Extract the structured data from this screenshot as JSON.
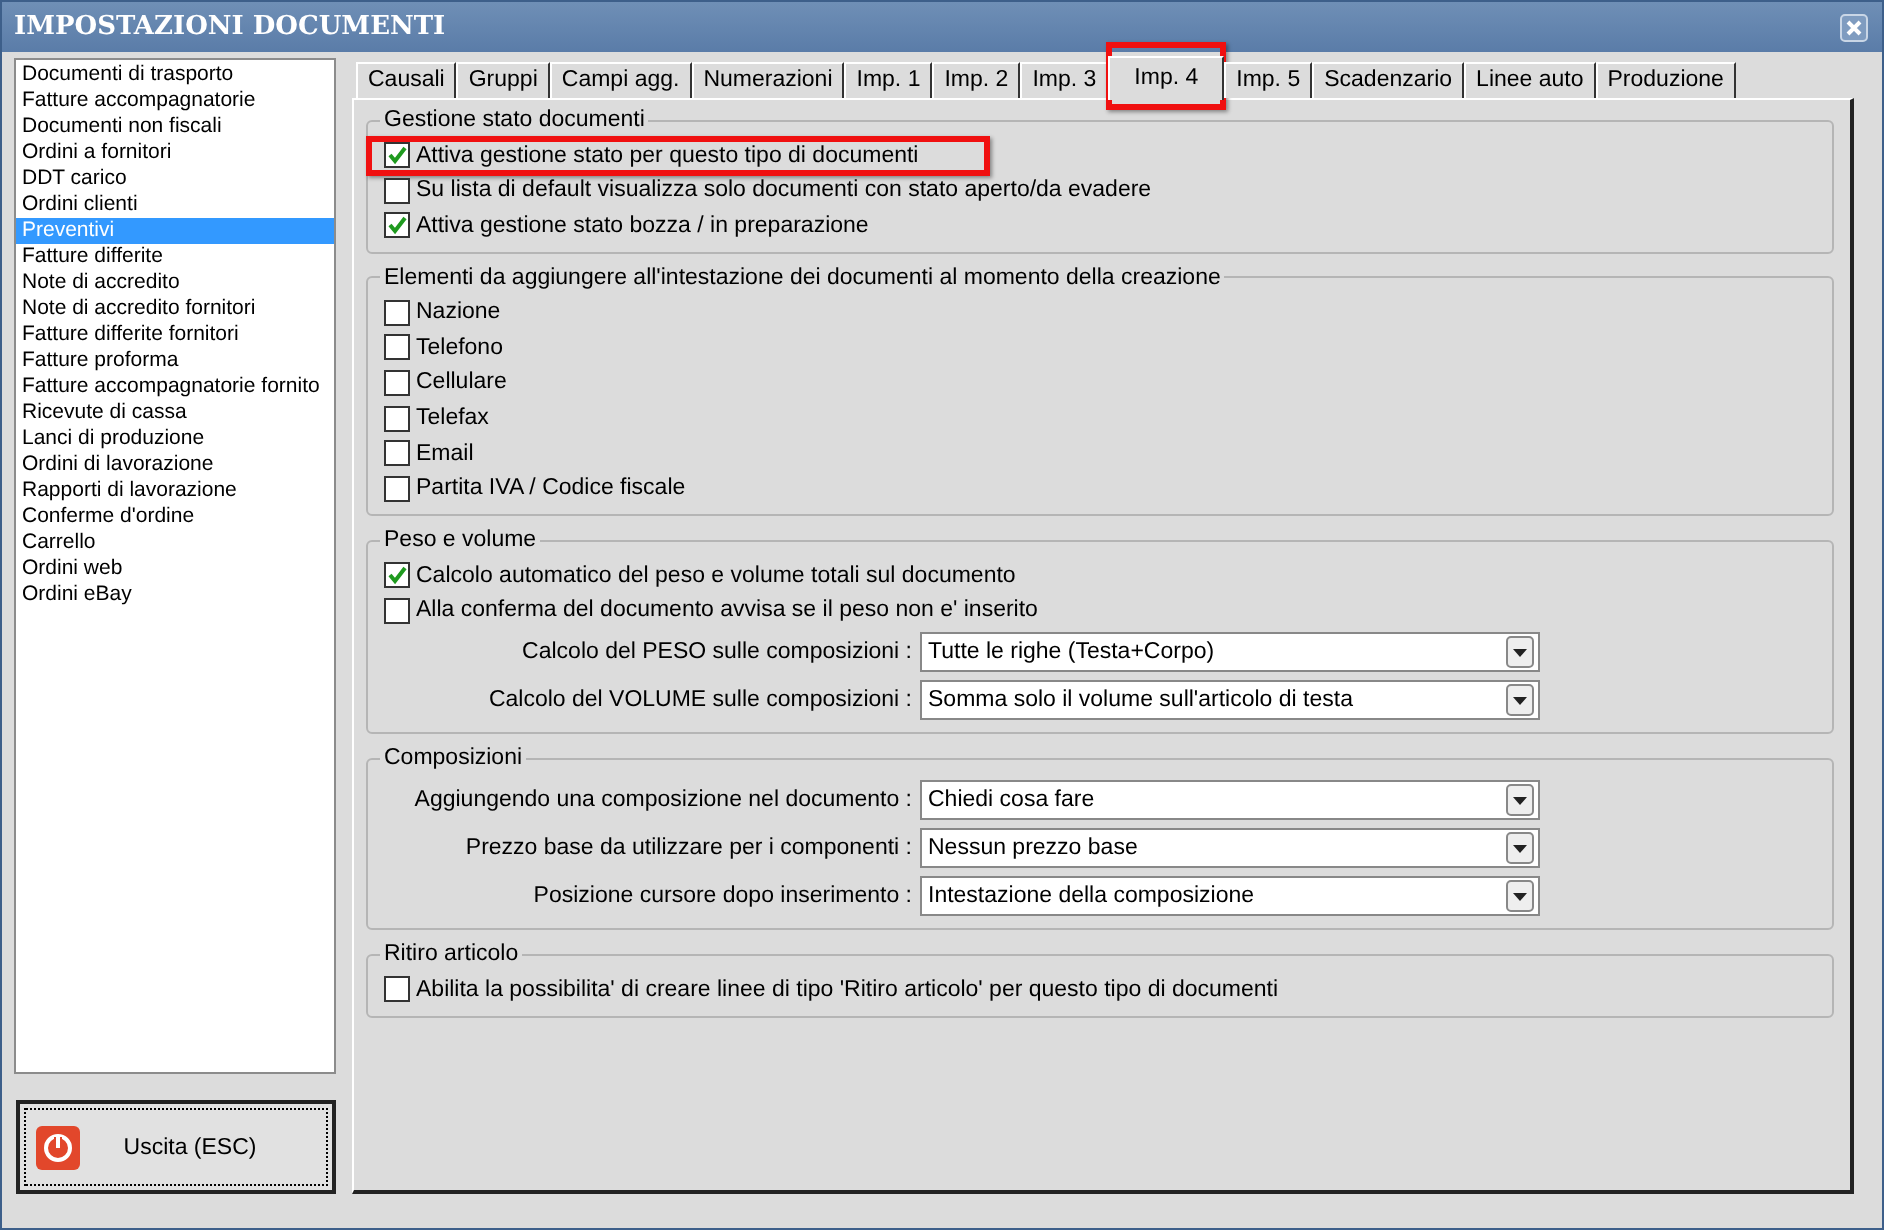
{
  "window": {
    "title": "IMPOSTAZIONI DOCUMENTI"
  },
  "sidebar": {
    "items": [
      {
        "label": "Documenti di trasporto",
        "selected": false
      },
      {
        "label": "Fatture accompagnatorie",
        "selected": false
      },
      {
        "label": "Documenti non fiscali",
        "selected": false
      },
      {
        "label": "Ordini a fornitori",
        "selected": false
      },
      {
        "label": "DDT carico",
        "selected": false
      },
      {
        "label": "Ordini clienti",
        "selected": false
      },
      {
        "label": "Preventivi",
        "selected": true
      },
      {
        "label": "Fatture differite",
        "selected": false
      },
      {
        "label": "Note di accredito",
        "selected": false
      },
      {
        "label": "Note di accredito fornitori",
        "selected": false
      },
      {
        "label": "Fatture differite fornitori",
        "selected": false
      },
      {
        "label": "Fatture proforma",
        "selected": false
      },
      {
        "label": "Fatture accompagnatorie fornito",
        "selected": false
      },
      {
        "label": "Ricevute di cassa",
        "selected": false
      },
      {
        "label": "Lanci di produzione",
        "selected": false
      },
      {
        "label": "Ordini di lavorazione",
        "selected": false
      },
      {
        "label": "Rapporti di lavorazione",
        "selected": false
      },
      {
        "label": "Conferme d'ordine",
        "selected": false
      },
      {
        "label": "Carrello",
        "selected": false
      },
      {
        "label": "Ordini web",
        "selected": false
      },
      {
        "label": "Ordini eBay",
        "selected": false
      }
    ]
  },
  "exit_button": {
    "label": "Uscita (ESC)"
  },
  "tabs": [
    {
      "label": "Causali",
      "selected": false,
      "highlighted": false
    },
    {
      "label": "Gruppi",
      "selected": false,
      "highlighted": false
    },
    {
      "label": "Campi agg.",
      "selected": false,
      "highlighted": false
    },
    {
      "label": "Numerazioni",
      "selected": false,
      "highlighted": false
    },
    {
      "label": "Imp. 1",
      "selected": false,
      "highlighted": false
    },
    {
      "label": "Imp. 2",
      "selected": false,
      "highlighted": false
    },
    {
      "label": "Imp. 3",
      "selected": false,
      "highlighted": false
    },
    {
      "label": "Imp. 4",
      "selected": true,
      "highlighted": true
    },
    {
      "label": "Imp. 5",
      "selected": false,
      "highlighted": false
    },
    {
      "label": "Scadenzario",
      "selected": false,
      "highlighted": false
    },
    {
      "label": "Linee auto",
      "selected": false,
      "highlighted": false
    },
    {
      "label": "Produzione",
      "selected": false,
      "highlighted": false
    }
  ],
  "sections": [
    {
      "title": "Gestione stato documenti",
      "rows": [
        {
          "kind": "checkbox",
          "label": "Attiva gestione stato per questo tipo di documenti",
          "checked": true,
          "highlighted": true
        },
        {
          "kind": "checkbox",
          "label": "Su lista di default visualizza solo documenti con stato aperto/da evadere",
          "checked": false,
          "highlighted": false
        },
        {
          "kind": "checkbox",
          "label": "Attiva gestione stato bozza / in preparazione",
          "checked": true,
          "highlighted": false
        }
      ]
    },
    {
      "title": "Elementi da aggiungere all'intestazione dei documenti al momento della creazione",
      "rows": [
        {
          "kind": "checkbox",
          "label": "Nazione",
          "checked": false,
          "highlighted": false
        },
        {
          "kind": "checkbox",
          "label": "Telefono",
          "checked": false,
          "highlighted": false
        },
        {
          "kind": "checkbox",
          "label": "Cellulare",
          "checked": false,
          "highlighted": false
        },
        {
          "kind": "checkbox",
          "label": "Telefax",
          "checked": false,
          "highlighted": false
        },
        {
          "kind": "checkbox",
          "label": "Email",
          "checked": false,
          "highlighted": false
        },
        {
          "kind": "checkbox",
          "label": "Partita IVA / Codice fiscale",
          "checked": false,
          "highlighted": false
        }
      ]
    },
    {
      "title": "Peso e volume",
      "rows": [
        {
          "kind": "checkbox",
          "label": "Calcolo automatico del peso e volume totali sul documento",
          "checked": true,
          "highlighted": false
        },
        {
          "kind": "checkbox",
          "label": "Alla conferma del documento avvisa se il peso non e' inserito",
          "checked": false,
          "highlighted": false
        },
        {
          "kind": "select",
          "label": "Calcolo del PESO sulle composizioni :",
          "value": "Tutte le righe (Testa+Corpo)"
        },
        {
          "kind": "select",
          "label": "Calcolo del VOLUME sulle composizioni :",
          "value": "Somma solo il volume sull'articolo di testa"
        }
      ]
    },
    {
      "title": "Composizioni",
      "rows": [
        {
          "kind": "select",
          "label": "Aggiungendo una composizione nel documento :",
          "value": "Chiedi cosa fare"
        },
        {
          "kind": "select",
          "label": "Prezzo base da utilizzare per i componenti :",
          "value": "Nessun prezzo base"
        },
        {
          "kind": "select",
          "label": "Posizione cursore dopo inserimento :",
          "value": "Intestazione della composizione"
        }
      ]
    },
    {
      "title": "Ritiro articolo",
      "rows": [
        {
          "kind": "checkbox",
          "label": "Abilita la possibilita' di creare linee di tipo 'Ritiro articolo' per questo tipo di documenti",
          "checked": false,
          "highlighted": false
        }
      ]
    }
  ]
}
